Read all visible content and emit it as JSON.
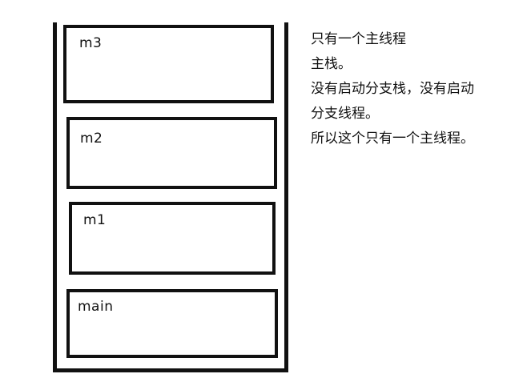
{
  "stack": {
    "frames": [
      {
        "label": "m3"
      },
      {
        "label": "m2"
      },
      {
        "label": "m1"
      },
      {
        "label": "main"
      }
    ]
  },
  "note": {
    "lines": [
      "只有一个主线程",
      "主栈。",
      "没有启动分支栈，没有启动",
      "分支线程。",
      "所以这个只有一个主线程。"
    ]
  }
}
